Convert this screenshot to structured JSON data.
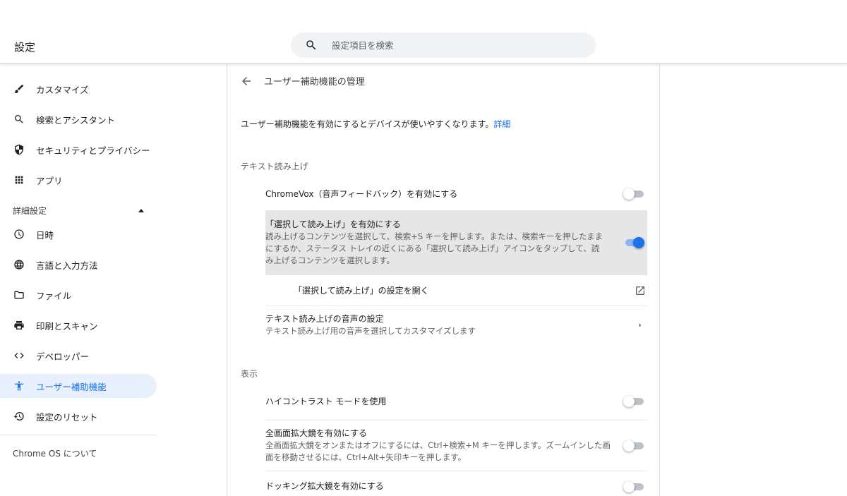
{
  "window": {
    "controls": [
      "minimize-icon",
      "restore-icon",
      "close-icon"
    ]
  },
  "header": {
    "title": "設定",
    "search_placeholder": "設定項目を検索"
  },
  "sidebar": {
    "items_top": [
      {
        "label": "カスタマイズ",
        "icon": "brush-icon"
      },
      {
        "label": "検索とアシスタント",
        "icon": "search-icon"
      },
      {
        "label": "セキュリティとプライバシー",
        "icon": "shield-icon"
      },
      {
        "label": "アプリ",
        "icon": "apps-grid-icon"
      }
    ],
    "advanced_label": "詳細設定",
    "items_advanced": [
      {
        "label": "日時",
        "icon": "clock-icon"
      },
      {
        "label": "言語と入力方法",
        "icon": "globe-icon"
      },
      {
        "label": "ファイル",
        "icon": "folder-icon"
      },
      {
        "label": "印刷とスキャン",
        "icon": "printer-icon"
      },
      {
        "label": "デベロッパー",
        "icon": "code-icon"
      },
      {
        "label": "ユーザー補助機能",
        "icon": "accessibility-icon",
        "active": true
      },
      {
        "label": "設定のリセット",
        "icon": "reset-icon"
      }
    ],
    "about": "Chrome OS について"
  },
  "main": {
    "title": "ユーザー補助機能の管理",
    "intro": "ユーザー補助機能を有効にするとデバイスが使いやすくなります。",
    "intro_link": "詳細",
    "tts_section": "テキスト読み上げ",
    "chromevox": {
      "label": "ChromeVox（音声フィードバック）を有効にする",
      "on": false
    },
    "select_to_speak": {
      "label": "「選択して読み上げ」を有効にする",
      "desc1": "読み上げるコンテンツを選択して、検索+S キーを押します。または、検索キーを押したまま",
      "desc2": "にするか、ステータス トレイの近くにある「選択して読み上げ」アイコンをタップして、読",
      "desc3": "み上げるコンテンツを選択します。",
      "on": true
    },
    "select_to_speak_settings": "「選択して読み上げ」の設定を開く",
    "tts_voice": {
      "label": "テキスト読み上げの音声の設定",
      "desc": "テキスト読み上げ用の音声を選択してカスタマイズします"
    },
    "display_section": "表示",
    "high_contrast": {
      "label": "ハイコントラスト モードを使用",
      "on": false
    },
    "fullscreen_magnifier": {
      "label": "全画面拡大鏡を有効にする",
      "desc1": "全画面拡大鏡をオンまたはオフにするには、Ctrl+検索+M キーを押します。ズームインした画",
      "desc2": "面を移動させるには、Ctrl+Alt+矢印キーを押します。",
      "on": false
    },
    "docked_magnifier": {
      "label": "ドッキング拡大鏡を有効にする",
      "on": false
    }
  },
  "colors": {
    "accent": "#1a73e8",
    "active_bg": "#e8f0fe",
    "highlight_row": "#e6e6e6"
  }
}
